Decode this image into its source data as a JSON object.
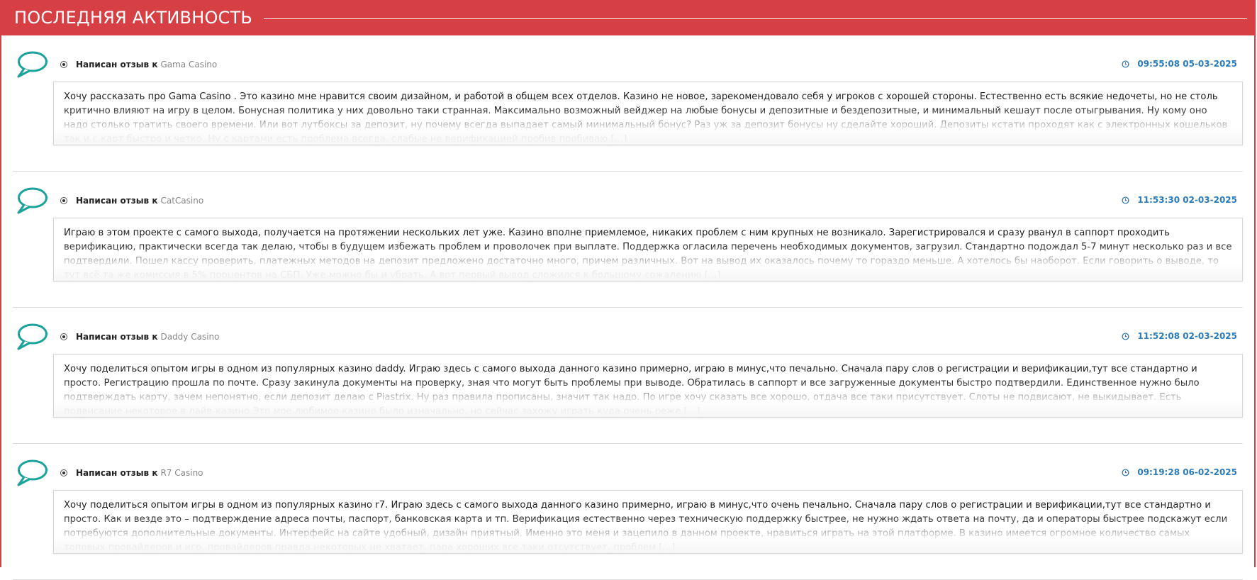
{
  "header": {
    "title": "ПОСЛЕДНЯЯ АКТИВНОСТЬ"
  },
  "colors": {
    "header_bg": "#d64045",
    "accent_teal": "#1aa39a",
    "timestamp_blue": "#2b7bb9"
  },
  "icons": {
    "avatar": "speech-bubble-icon",
    "marker": "radio-icon",
    "time": "clock-icon"
  },
  "entries": [
    {
      "label": "Написан отзыв к",
      "casino": "Gama Casino",
      "timestamp": "09:55:08 05-03-2025",
      "text": "Хочу рассказать про Gama Casino . Это казино мне нравится своим дизайном, и работой в общем всех отделов. Казино не новое, зарекомендовало себя у игроков с хорошей стороны. Естественно есть всякие недочеты, но не столь критично влияют на игру в целом. Бонусная политика у них довольно таки странная. Максимально возможный вейджер на любые бонусы и депозитные и бездепозитные, и минимальный кешаут после отыгрывания. Ну кому оно надо столько тратить своего времени. Или вот лутбоксы за депозит, ну почему всегда выпадает самый минимальный бонус? Раз уж за депозит бонусы ну сделайте хороший. Депозиты кстати проходят как с электронных кошельков так и с карт быстро и четко. Ну с картами есть проблема всегда, слабые не верификацией пробив пробиваю [...]"
    },
    {
      "label": "Написан отзыв к",
      "casino": "CatCasino",
      "timestamp": "11:53:30 02-03-2025",
      "text": "Играю в этом проекте с самого выхода, получается на протяжении нескольких лет уже. Казино вполне приемлемое, никаких проблем с ним крупных не возникало. Зарегистрировался и сразу рванул в саппорт проходить верификацию, практически всегда так делаю, чтобы в будущем избежать проблем и проволочек при выплате. Поддержка огласила перечень необходимых документов, загрузил. Стандартно подождал 5-7 минут несколько раз и все подтвердили. Пошел кассу проверить, платежных методов на депозит предложено достаточно много, причем различных. Вот на вывод их оказалось почему то гораздо меньше. А хотелось бы наоборот. Если говорить о выводе, то тут всё та же комиссия в 5% процентов на СБП. Уже можно бы и убрать. А вот первый вывод сложился к большому сожалению [...]"
    },
    {
      "label": "Написан отзыв к",
      "casino": "Daddy Casino",
      "timestamp": "11:52:08 02-03-2025",
      "text": "Хочу поделиться опытом игры в одном из популярных казино daddy. Играю здесь с самого выхода данного казино примерно, играю в минус,что печально. Сначала пару слов о регистрации и верификации,тут все стандартно и просто. Регистрацию прошла по почте. Сразу закинула документы на проверку, зная что могут быть проблемы при выводе. Обратилась в саппорт и все загруженные документы быстро подтвердили. Единственное нужно было подтверждать карту, зачем непонятно, если депозит делаю с Piastrix. Ну раз правила прописаны, значит так надо. По игре хочу сказать все хорошо, отдача все таки присутствует. Слоты не подвисают, не выкидывает. Есть подвисание некоторое в лайв-казино.Это мое любимое казино было изначально, но сейчас захожу играть куда очень реже [...]"
    },
    {
      "label": "Написан отзыв к",
      "casino": "R7 Casino",
      "timestamp": "09:19:28 06-02-2025",
      "text": "Хочу поделиться опытом игры в одном из популярных казино r7. Играю здесь с самого выхода данного казино примерно, играю в минус,что очень печально. Сначала пару слов о регистрации и верификации,тут все стандартно и просто. Как и везде это – подтверждение адреса почты, паспорт, банковская карта и тп. Верификация естественно через техническую поддержку быстрее, не нужно ждать ответа на почту, да и операторы быстрее подскажут если потребуются дополнительные документы. Интерфейс на сайте удобный, дизайн приятный. Именно это меня и зацепило в данном проекте, нравиться играть на этой платформе. В казино имеется огромное количество самых топовых провайдеров и игр, провайдеров правда некоторых не хватает, пара хороших все таки отсутствует, проблем [...]"
    }
  ]
}
